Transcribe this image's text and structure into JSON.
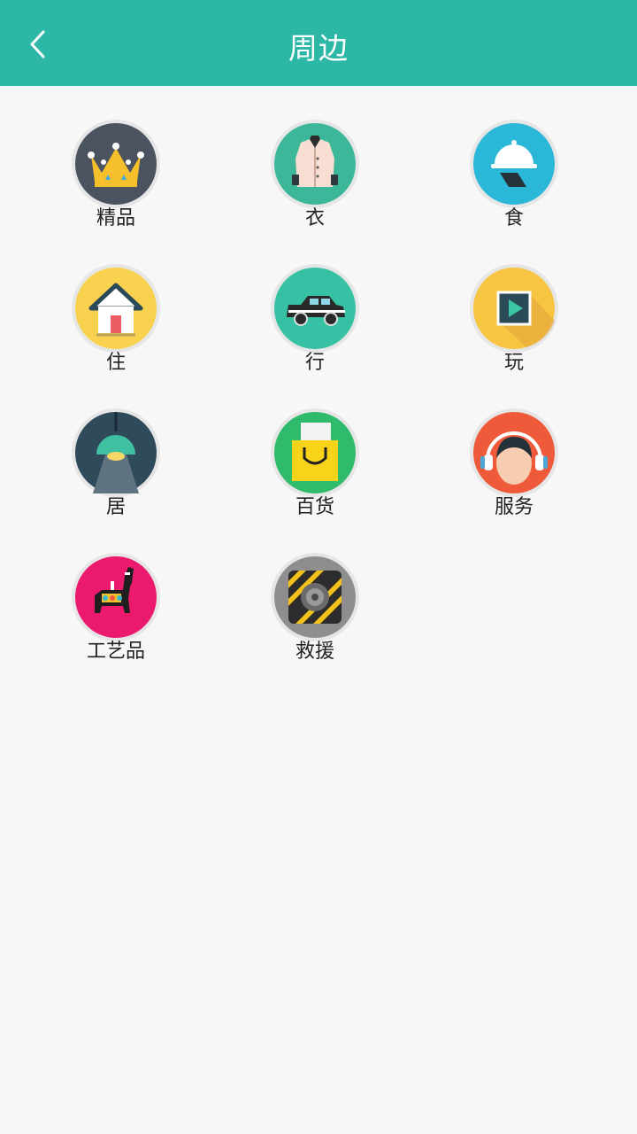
{
  "header": {
    "title": "周边",
    "background": "#2cb7a6"
  },
  "categories": [
    {
      "label": "精品",
      "icon": "crown-icon"
    },
    {
      "label": "衣",
      "icon": "coat-icon"
    },
    {
      "label": "食",
      "icon": "food-cloche-icon"
    },
    {
      "label": "住",
      "icon": "house-icon"
    },
    {
      "label": "行",
      "icon": "car-icon"
    },
    {
      "label": "玩",
      "icon": "play-icon"
    },
    {
      "label": "居",
      "icon": "ceiling-lamp-icon"
    },
    {
      "label": "百货",
      "icon": "shopping-bag-icon"
    },
    {
      "label": "服务",
      "icon": "headset-agent-icon"
    },
    {
      "label": "工艺品",
      "icon": "craft-alpaca-icon"
    },
    {
      "label": "救援",
      "icon": "rescue-gear-icon"
    }
  ]
}
